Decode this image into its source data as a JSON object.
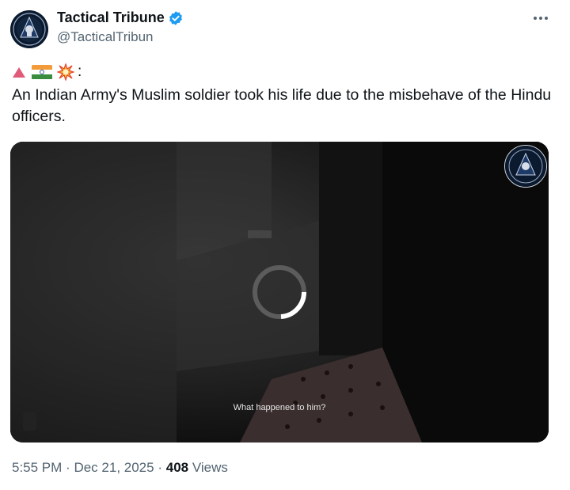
{
  "account": {
    "name": "Tactical Tribune",
    "handle": "@TacticalTribun"
  },
  "tweet": {
    "emoji_suffix": ":",
    "text": "An Indian Army's Muslim soldier took his life due to the misbehave of the Hindu officers."
  },
  "video": {
    "caption": "What happened to him?"
  },
  "meta": {
    "time": "5:55 PM",
    "separator": "·",
    "date": "Dec 21, 2025",
    "views_count": "408",
    "views_label": "Views"
  },
  "colors": {
    "verified": "#1d9bf0",
    "secondary_text": "#536471"
  },
  "icons": [
    "verified-badge-icon",
    "more-icon",
    "red-triangle-emoji-icon",
    "india-flag-emoji-icon",
    "collision-emoji-icon",
    "loading-spinner-icon"
  ]
}
